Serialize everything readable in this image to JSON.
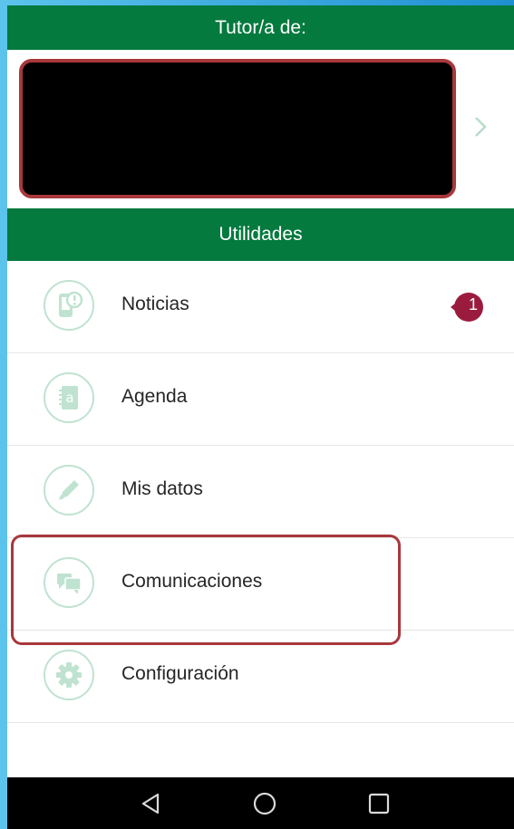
{
  "tutor": {
    "header": "Tutor/a de:"
  },
  "utilities": {
    "header": "Utilidades",
    "items": [
      {
        "label": "Noticias",
        "icon": "news-phone-icon",
        "badge": "1"
      },
      {
        "label": "Agenda",
        "icon": "agenda-book-icon"
      },
      {
        "label": "Mis datos",
        "icon": "pencil-icon"
      },
      {
        "label": "Comunicaciones",
        "icon": "chat-bubbles-icon"
      },
      {
        "label": "Configuración",
        "icon": "gear-icon"
      }
    ]
  },
  "colors": {
    "header_green": "#047a3f",
    "icon_green": "#bfe3d0",
    "badge": "#9b1b3e",
    "highlight": "#a8383c"
  }
}
